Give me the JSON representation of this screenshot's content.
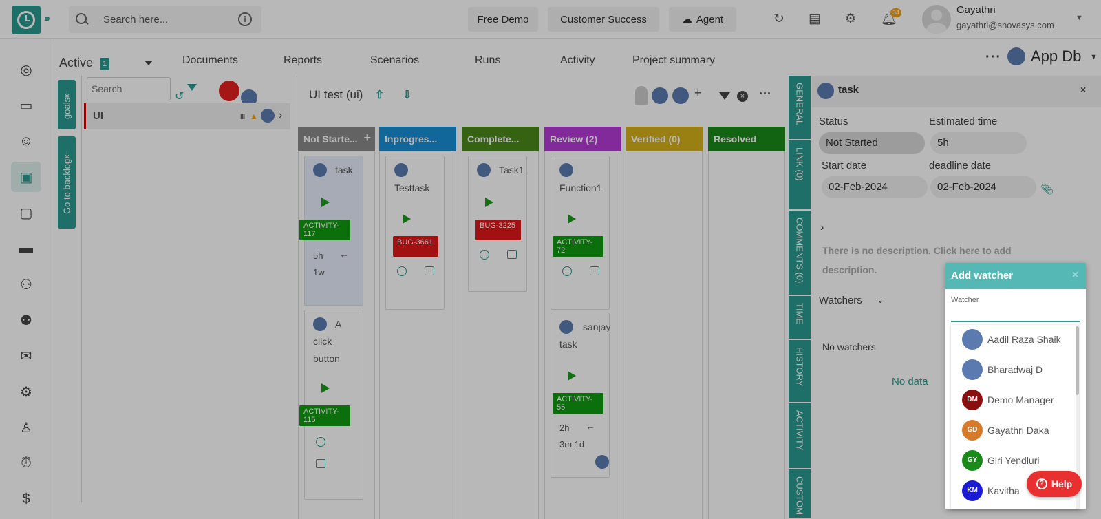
{
  "header": {
    "search_placeholder": "Search here...",
    "buttons": {
      "free_demo": "Free Demo",
      "customer_success": "Customer Success",
      "agent": "Agent"
    },
    "notification_count": "34",
    "user": {
      "name": "Gayathri",
      "email": "gayathri@snovasys.com"
    }
  },
  "subheader": {
    "active_label": "Active",
    "active_count": "1",
    "tabs": [
      "Documents",
      "Reports",
      "Scenarios",
      "Runs",
      "Activity",
      "Project summary"
    ],
    "project_name": "App Db"
  },
  "goals": {
    "tab_goals": "goals",
    "tab_backlog": "Go to backlog",
    "search_placeholder": "Search",
    "goal_label": "UI"
  },
  "board": {
    "title": "UI test (ui)",
    "columns": [
      {
        "title": "Not Starte...",
        "color": "#8a8a8a"
      },
      {
        "title": "Inprogres...",
        "color": "#1a8fd6"
      },
      {
        "title": "Complete...",
        "color": "#4a8a1a"
      },
      {
        "title": "Review (2)",
        "color": "#b53bd6"
      },
      {
        "title": "Verified (0)",
        "color": "#d6b21a"
      },
      {
        "title": "Resolved",
        "color": "#1a8a1a"
      }
    ],
    "cards": {
      "c1": {
        "title": "task",
        "tag": "ACTIVITY-117",
        "meta1": "5h",
        "meta2": "1w"
      },
      "c2": {
        "title": "A click button",
        "tag": "ACTIVITY-115"
      },
      "c3": {
        "title": "Testtask",
        "tag": "BUG-3661"
      },
      "c4": {
        "title": "Task1",
        "tag": "BUG-3225"
      },
      "c5": {
        "title": "Function1",
        "tag": "ACTIVITY-72"
      },
      "c6": {
        "title": "sanjay task",
        "tag": "ACTIVITY-55",
        "meta1": "2h",
        "meta2": "3m 1d"
      }
    }
  },
  "right_tabs": [
    "GENERAL",
    "LINK (0)",
    "COMMENTS (0)",
    "TIME",
    "HISTORY",
    "ACTIVITY",
    "CUSTOM"
  ],
  "detail": {
    "title": "task",
    "status_label": "Status",
    "status_value": "Not Started",
    "estimated_label": "Estimated time",
    "estimated_value": "5h",
    "start_label": "Start date",
    "start_value": "02-Feb-2024",
    "deadline_label": "deadline date",
    "deadline_value": "02-Feb-2024",
    "description": "There is no description. Click here to add description.",
    "watchers_label": "Watchers",
    "no_watchers": "No watchers",
    "no_data": "No data"
  },
  "popup": {
    "title": "Add watcher",
    "field_label": "Watcher",
    "options": [
      {
        "name": "Aadil Raza Shaik",
        "initials": "",
        "color": "#5b7ab0"
      },
      {
        "name": "Bharadwaj D",
        "initials": "",
        "color": "#5b7ab0"
      },
      {
        "name": "Demo Manager",
        "initials": "DM",
        "color": "#8a0e0e"
      },
      {
        "name": "Gayathri Daka",
        "initials": "GD",
        "color": "#d67a2a"
      },
      {
        "name": "Giri Yendluri",
        "initials": "GY",
        "color": "#1a8a1a"
      },
      {
        "name": "Kavitha",
        "initials": "KM",
        "color": "#1a1ad6"
      }
    ]
  },
  "help_label": "Help"
}
